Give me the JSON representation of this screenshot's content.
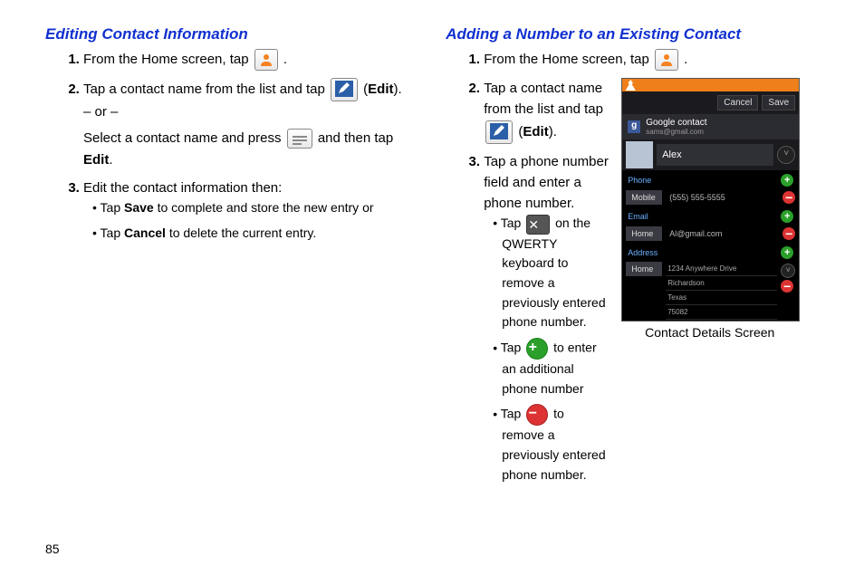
{
  "page_number": "85",
  "left": {
    "heading": "Editing Contact Information",
    "steps": {
      "s1a": "From the Home screen, tap ",
      "s1b": " .",
      "s2a": "Tap a contact name from the list and tap ",
      "s2b": " (",
      "s2c": "Edit",
      "s2d": "). – or –",
      "s2e": "Select a contact name and press ",
      "s2f": " and then tap ",
      "s2g": "Edit",
      "s2h": ".",
      "s3": "Edit the contact information then:",
      "s3b1a": "Tap ",
      "s3b1b": "Save",
      "s3b1c": " to complete and store the new entry or",
      "s3b2a": "Tap ",
      "s3b2b": "Cancel",
      "s3b2c": " to delete the current entry."
    }
  },
  "right": {
    "heading": "Adding a Number to an Existing Contact",
    "steps": {
      "s1a": "From the Home screen, tap ",
      "s1b": " .",
      "s2a": "Tap a contact name from the list and tap ",
      "s2b": " (",
      "s2c": "Edit",
      "s2d": ").",
      "s3": "Tap a phone number field and enter a phone number.",
      "s3b1a": "Tap ",
      "s3b1b": " on the QWERTY keyboard to remove a previously entered phone number.",
      "s3b2a": "Tap ",
      "s3b2b": " to enter an additional phone number",
      "s3b3a": "Tap ",
      "s3b3b": " to remove a previously entered phone number."
    },
    "phone": {
      "cancel": "Cancel",
      "save": "Save",
      "gc_title": "Google contact",
      "gc_email": "sams@gmail.com",
      "name": "Alex",
      "phone_label": "Phone",
      "phone_type": "Mobile",
      "phone_value": "(555) 555-5555",
      "email_label": "Email",
      "email_type": "Home",
      "email_value": "Al@gmail.com",
      "addr_label": "Address",
      "addr_type": "Home",
      "addr_line1": "1234 Anywhere Drive",
      "addr_line2": "Richardson",
      "addr_line3": "Texas",
      "addr_line4": "75082",
      "caption": "Contact Details Screen"
    }
  }
}
